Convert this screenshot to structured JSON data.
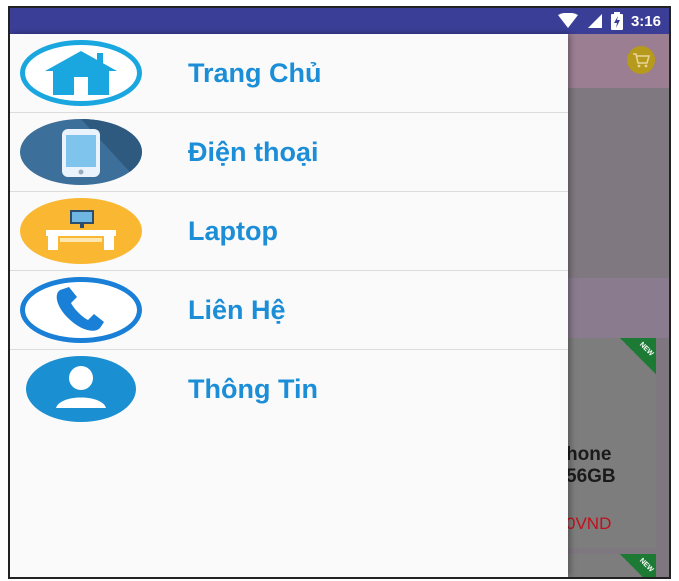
{
  "status_bar": {
    "time": "3:16",
    "icons": [
      "wifi-icon",
      "signal-icon",
      "battery-icon"
    ]
  },
  "background_app": {
    "cart_icon": "cart-icon",
    "product_card": {
      "badge": "NEW",
      "title_line1": "hone",
      "title_line2": "56GB",
      "price": "0VND"
    },
    "second_card_badge": "NEW"
  },
  "drawer": {
    "items": [
      {
        "label": "Trang Chủ",
        "icon": "home-icon"
      },
      {
        "label": "Điện thoại",
        "icon": "phone-icon"
      },
      {
        "label": "Laptop",
        "icon": "laptop-icon"
      },
      {
        "label": "Liên Hệ",
        "icon": "contact-icon"
      },
      {
        "label": "Thông Tin",
        "icon": "user-icon"
      }
    ]
  },
  "colors": {
    "status_bar": "#3a3e96",
    "menu_text": "#1b8ed7",
    "drawer_bg": "#fafafa",
    "laptop_icon_bg": "#f9b732",
    "home_icon_ring": "#1aa7e0"
  }
}
